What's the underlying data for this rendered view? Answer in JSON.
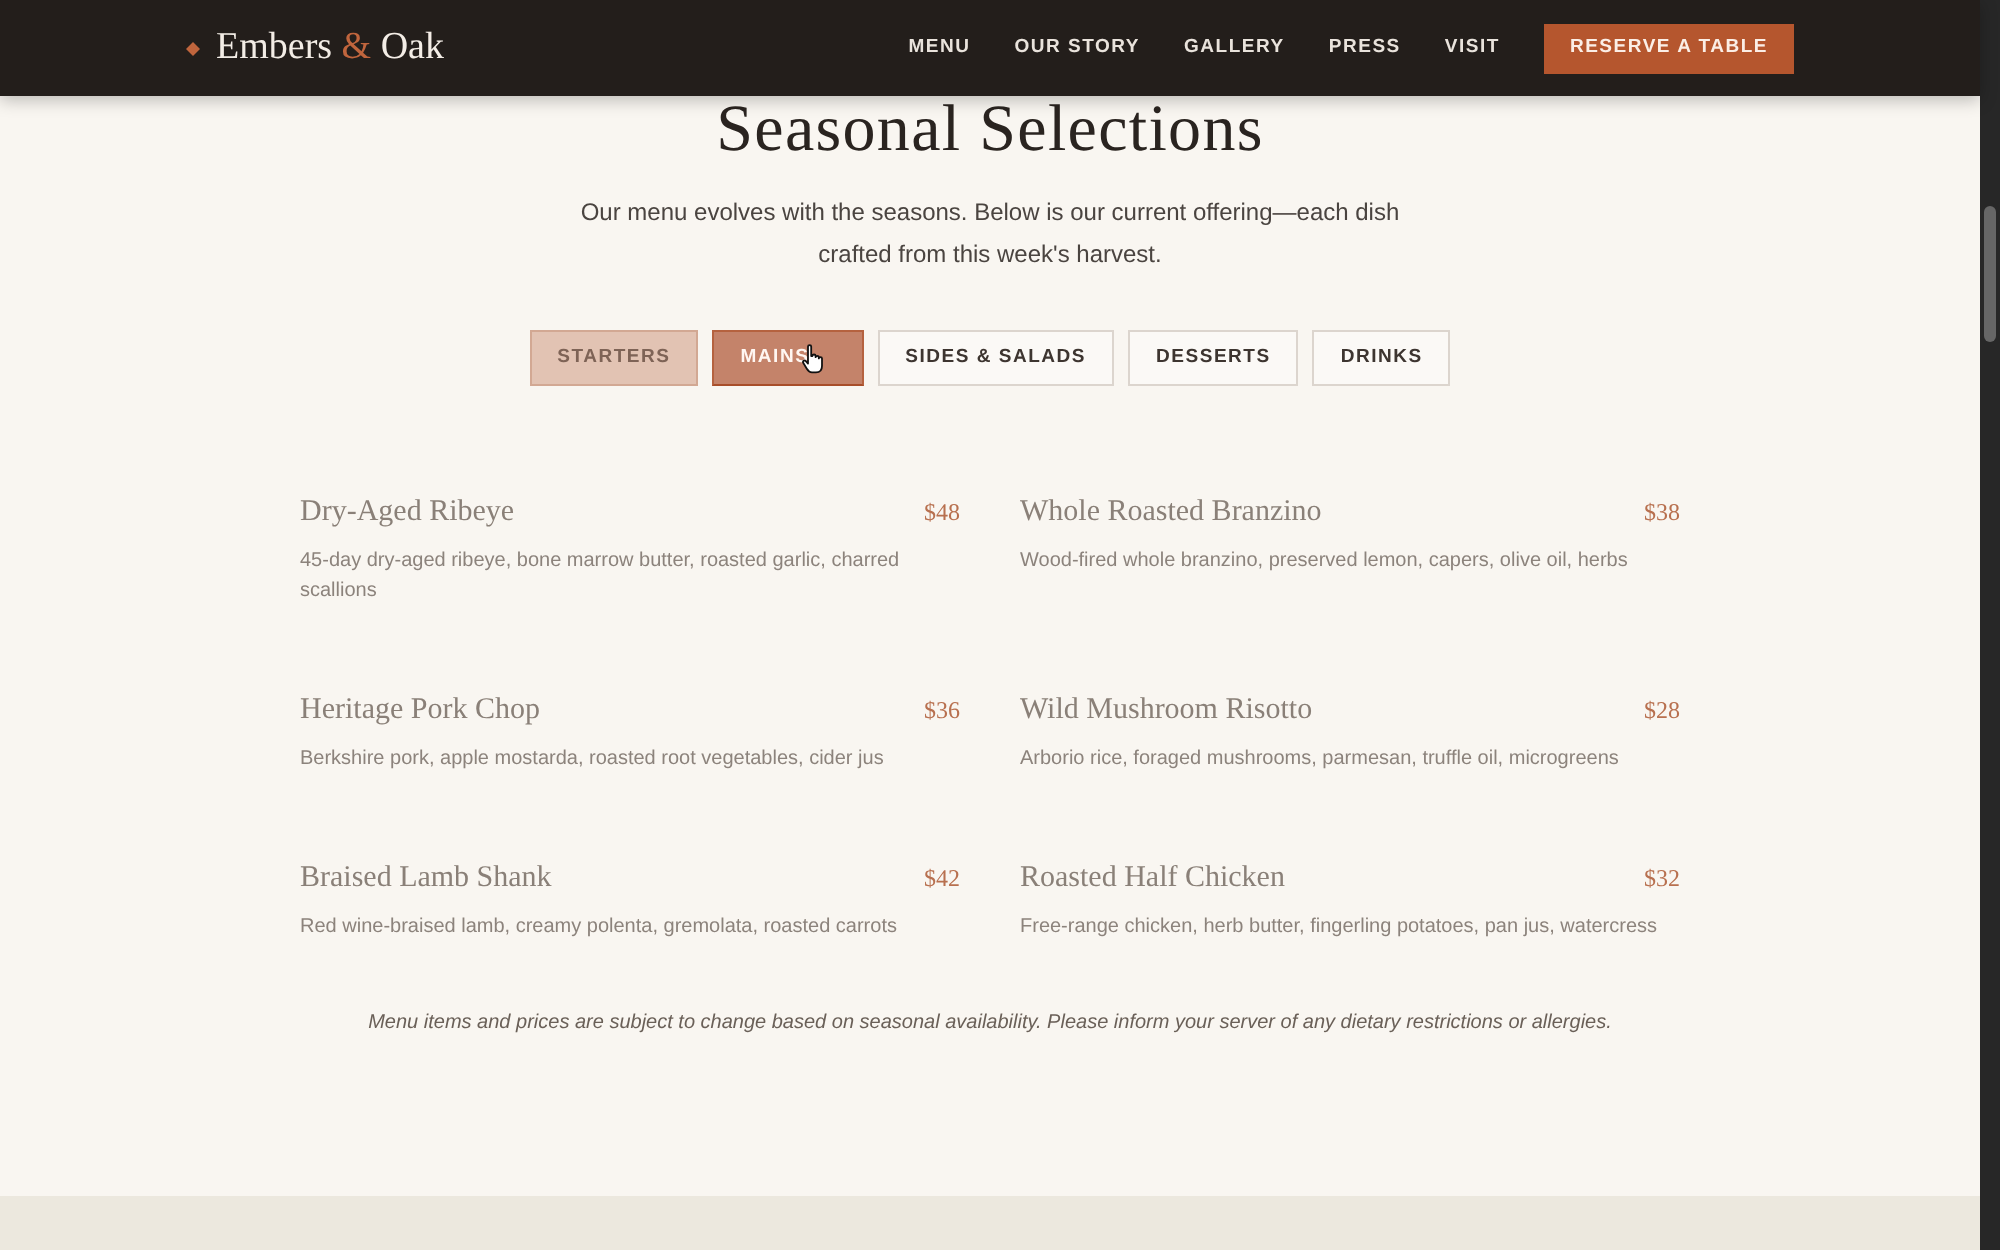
{
  "header": {
    "logo": {
      "first": "Embers",
      "ampersand": "&",
      "last": "Oak"
    },
    "nav": [
      "MENU",
      "OUR STORY",
      "GALLERY",
      "PRESS",
      "VISIT"
    ],
    "cta": "RESERVE A TABLE"
  },
  "section": {
    "title": "Seasonal Selections",
    "intro": "Our menu evolves with the seasons. Below is our current offering—each dish crafted from this week's harvest."
  },
  "tabs": [
    {
      "label": "STARTERS",
      "selected": false,
      "fading": true
    },
    {
      "label": "MAINS",
      "selected": true,
      "fading": false
    },
    {
      "label": "SIDES & SALADS",
      "selected": false,
      "fading": false
    },
    {
      "label": "DESSERTS",
      "selected": false,
      "fading": false
    },
    {
      "label": "DRINKS",
      "selected": false,
      "fading": false
    }
  ],
  "menu": {
    "fading": true,
    "items": [
      {
        "name": "Dry-Aged Ribeye",
        "price": "$48",
        "description": "45-day dry-aged ribeye, bone marrow butter, roasted garlic, charred scallions"
      },
      {
        "name": "Whole Roasted Branzino",
        "price": "$38",
        "description": "Wood-fired whole branzino, preserved lemon, capers, olive oil, herbs"
      },
      {
        "name": "Heritage Pork Chop",
        "price": "$36",
        "description": "Berkshire pork, apple mostarda, roasted root vegetables, cider jus"
      },
      {
        "name": "Wild Mushroom Risotto",
        "price": "$28",
        "description": "Arborio rice, foraged mushrooms, parmesan, truffle oil, microgreens"
      },
      {
        "name": "Braised Lamb Shank",
        "price": "$42",
        "description": "Red wine-braised lamb, creamy polenta, gremolata, roasted carrots"
      },
      {
        "name": "Roasted Half Chicken",
        "price": "$32",
        "description": "Free-range chicken, herb butter, fingerling potatoes, pan jus, watercress"
      }
    ]
  },
  "note": "Menu items and prices are subject to change based on seasonal availability. Please inform your server of any dietary restrictions or allergies."
}
